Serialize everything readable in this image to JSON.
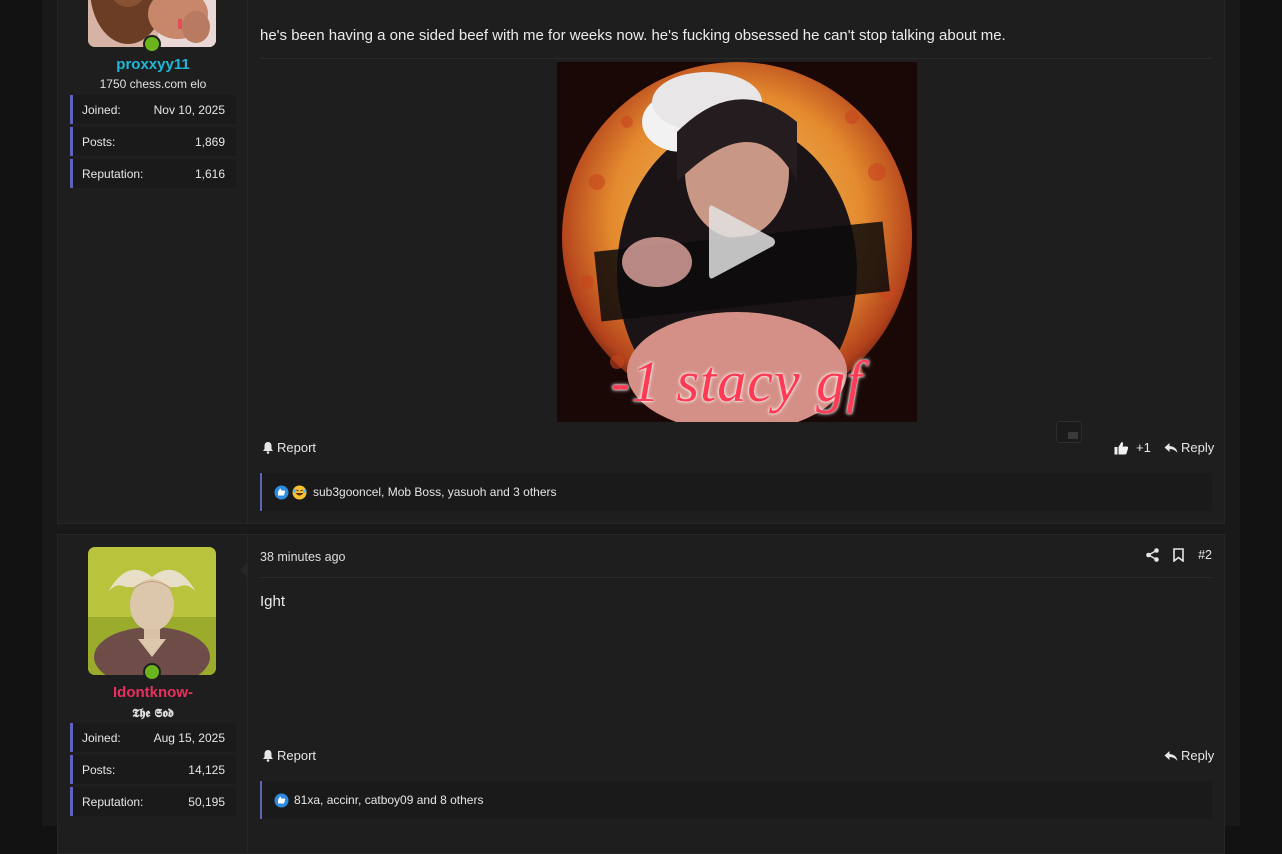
{
  "posts": [
    {
      "username": "proxxyy11",
      "user_title": "1750 chess.com elo",
      "stats": [
        {
          "label": "Joined:",
          "value": "Nov 10, 2025"
        },
        {
          "label": "Posts:",
          "value": "1,869"
        },
        {
          "label": "Reputation:",
          "value": "1,616"
        }
      ],
      "message": "he's been having a one sided beef with me for weeks now. he's fucking obsessed he can't stop talking about me.",
      "video_caption": "-1 stacy gf",
      "report_label": "Report",
      "like_count": "+1",
      "reply_label": "Reply",
      "reactions_text": "sub3gooncel, Mob Boss, yasuoh and 3 others"
    },
    {
      "username": "Idontknow-",
      "user_title": "𝕿𝖍𝖊 𝕾𝖔𝖉",
      "stats": [
        {
          "label": "Joined:",
          "value": "Aug 15, 2025"
        },
        {
          "label": "Posts:",
          "value": "14,125"
        },
        {
          "label": "Reputation:",
          "value": "50,195"
        }
      ],
      "time": "38 minutes ago",
      "post_number": "#2",
      "message": "Ight",
      "report_label": "Report",
      "reply_label": "Reply",
      "reactions_text": "81xa, accinr, catboy09 and 8 others"
    }
  ],
  "colors": {
    "username1": "#1fb7d8",
    "username2": "#e8305e",
    "accent": "#5d63b8",
    "online": "#6cb41d"
  },
  "icons": [
    "bell-icon",
    "thumbs-up-icon",
    "reply-icon",
    "share-icon",
    "bookmark-icon",
    "play-icon",
    "picture-in-picture-icon",
    "like-reaction-icon",
    "laugh-reaction-icon"
  ]
}
